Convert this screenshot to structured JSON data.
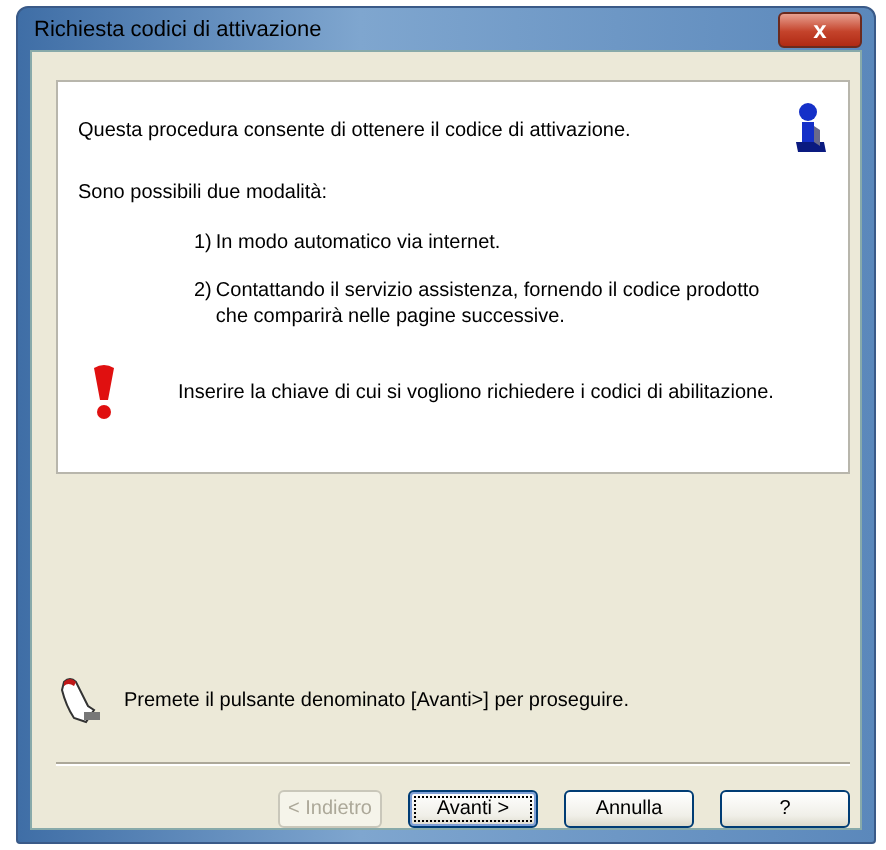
{
  "window": {
    "title": "Richiesta codici di attivazione",
    "close": "x"
  },
  "panel": {
    "intro": "Questa procedura consente di ottenere il codice di attivazione.",
    "modes_heading": "Sono possibili due modalità:",
    "options": [
      {
        "number": "1)",
        "lines": [
          "In modo automatico via internet."
        ]
      },
      {
        "number": "2)",
        "lines": [
          "Contattando il servizio assistenza, fornendo il codice prodotto",
          "che comparirà nelle pagine successive."
        ]
      }
    ],
    "warning": "Inserire la chiave di cui si vogliono richiedere i codici di abilitazione."
  },
  "hint": "Premete il pulsante denominato [Avanti>] per proseguire.",
  "buttons": [
    {
      "label": "< Indietro",
      "disabled": true,
      "default": false
    },
    {
      "label": "Avanti >",
      "disabled": false,
      "default": true
    },
    {
      "label": "Annulla",
      "disabled": false,
      "default": false
    },
    {
      "label": "?",
      "disabled": false,
      "default": false
    }
  ]
}
